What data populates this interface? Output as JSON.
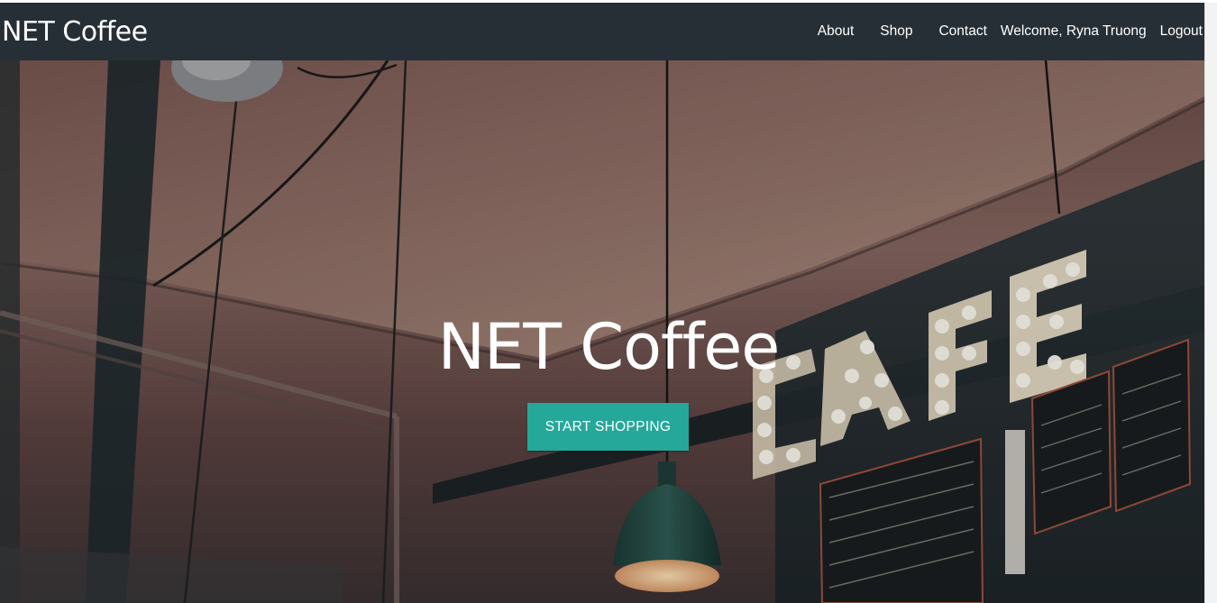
{
  "navbar": {
    "brand": "NET Coffee",
    "links": {
      "about": "About",
      "shop": "Shop",
      "contact": "Contact",
      "welcome": "Welcome, Ryna Truong",
      "logout": "Logout"
    }
  },
  "hero": {
    "title": "NET Coffee",
    "cta_label": "START SHOPPING"
  },
  "colors": {
    "navbar_bg": "#262f36",
    "cta_bg": "#25a89a",
    "text": "#ffffff"
  }
}
